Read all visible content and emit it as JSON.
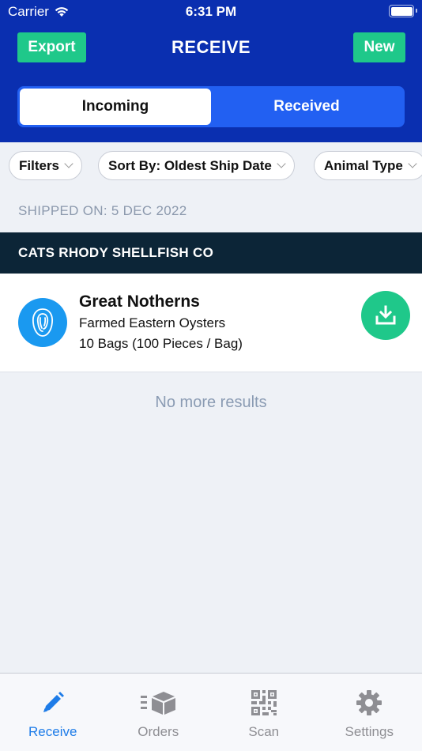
{
  "status": {
    "carrier": "Carrier",
    "time": "6:31 PM"
  },
  "header": {
    "title": "RECEIVE",
    "export_label": "Export",
    "new_label": "New",
    "tabs": [
      {
        "label": "Incoming",
        "active": true
      },
      {
        "label": "Received",
        "active": false
      }
    ]
  },
  "filters": {
    "filters_label": "Filters",
    "sort_label": "Sort By: Oldest Ship Date",
    "animal_type_label": "Animal Type"
  },
  "list": {
    "section_header": "SHIPPED ON: 5 DEC 2022",
    "vendor": "CATS RHODY SHELLFISH CO",
    "item": {
      "name": "Great Notherns",
      "type": "Farmed Eastern Oysters",
      "quantity": "10 Bags (100 Pieces / Bag)",
      "icon": "oyster-icon"
    },
    "end_text": "No more results"
  },
  "tabbar": {
    "items": [
      {
        "label": "Receive",
        "icon": "pencil-icon",
        "active": true
      },
      {
        "label": "Orders",
        "icon": "box-icon",
        "active": false
      },
      {
        "label": "Scan",
        "icon": "qr-code-icon",
        "active": false
      },
      {
        "label": "Settings",
        "icon": "gear-icon",
        "active": false
      }
    ]
  },
  "colors": {
    "header_bg": "#0a2fb0",
    "accent_green": "#1fc88a",
    "vendor_bar": "#0c2537",
    "active_tab": "#1e7ce8"
  }
}
